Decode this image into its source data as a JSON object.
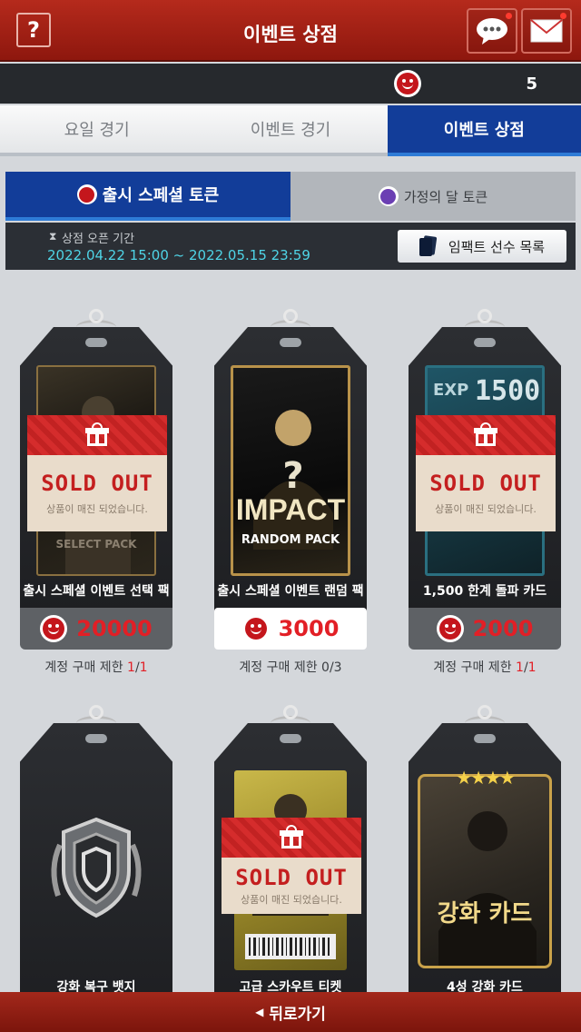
{
  "header": {
    "help_label": "?",
    "title": "이벤트 상점"
  },
  "currency": {
    "amount": "5"
  },
  "main_tabs": [
    {
      "label": "요일 경기"
    },
    {
      "label": "이벤트 경기"
    },
    {
      "label": "이벤트 상점"
    }
  ],
  "sub_tabs": [
    {
      "label": "출시 스페셜 토큰"
    },
    {
      "label": "가정의 달 토큰"
    }
  ],
  "shop_info": {
    "label": "상점 오픈 기간",
    "period": "2022.04.22 15:00 ~ 2022.05.15 23:59",
    "impact_button": "임팩트 선수 목록"
  },
  "items": [
    {
      "name": "출시 스페셜 이벤트 선택 팩",
      "price": "20000",
      "limit_label": "계정 구매 제한",
      "bought": "1",
      "max": "1",
      "sold_out": true,
      "pack_text": "SELECT PACK"
    },
    {
      "name": "출시 스페셜 이벤트 랜덤 팩",
      "price": "3000",
      "limit_label": "계정 구매 제한 0/3",
      "sold_out": false,
      "pack_title": "IMPACT",
      "pack_sub": "RANDOM PACK"
    },
    {
      "name": "1,500 한계 돌파 카드",
      "price": "2000",
      "limit_label": "계정 구매 제한",
      "bought": "1",
      "max": "1",
      "sold_out": true,
      "exp_label": "EXP",
      "exp_value": "1500"
    },
    {
      "name": "강화 복구 뱃지"
    },
    {
      "name": "고급 스카우트 티켓",
      "sold_out": true
    },
    {
      "name": "4성 강화 카드",
      "card_label": "강화 카드",
      "stars": "★★★★"
    }
  ],
  "sold_out": {
    "title": "SOLD OUT",
    "subtitle": "상품이 매진 되었습니다."
  },
  "bottom": {
    "back_label": "뒤로가기"
  },
  "colors": {
    "header_red": "#b52a1c",
    "tab_blue": "#123d99",
    "price_red": "#e21f26",
    "date_cyan": "#4fd4e6"
  }
}
